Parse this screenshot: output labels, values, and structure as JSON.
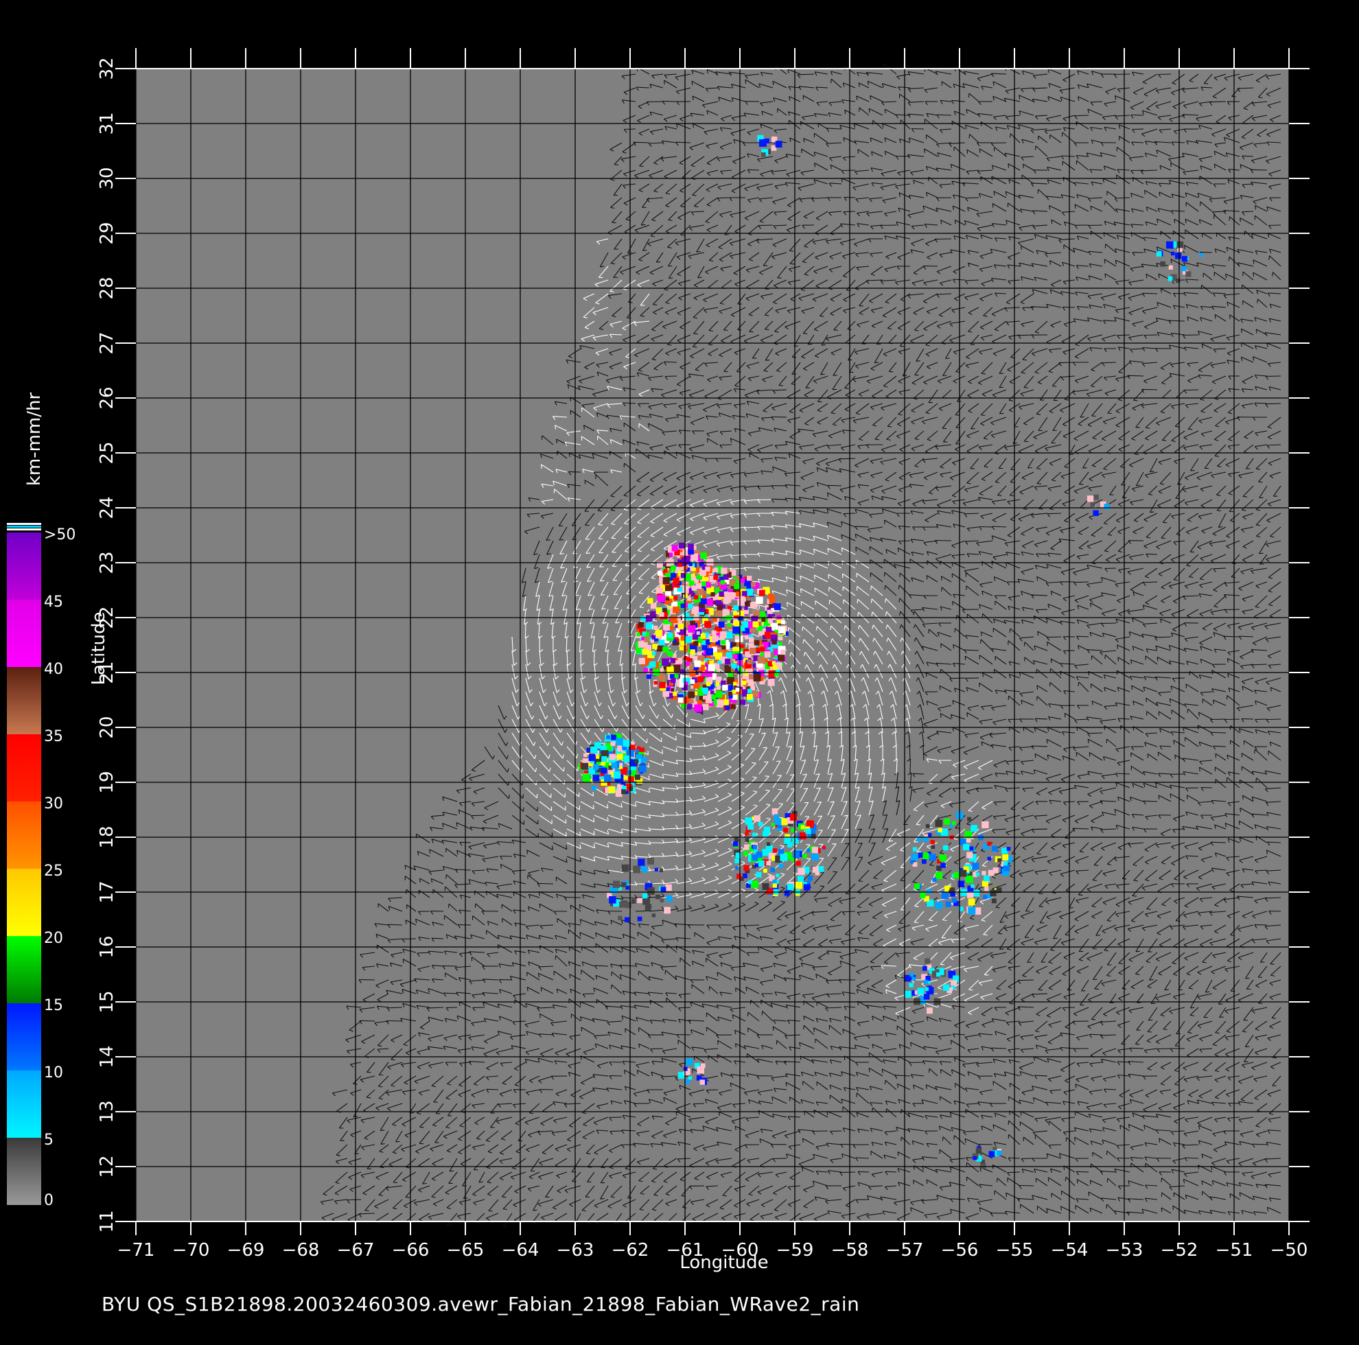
{
  "caption": "BYU  QS_S1B21898.20032460309.avewr_Fabian_21898_Fabian_WRave2_rain",
  "axes": {
    "x_title": "Longitude",
    "y_title": "Latitude",
    "x_range": [
      -71,
      -50
    ],
    "y_range": [
      11,
      32
    ],
    "x_ticks": [
      "-71",
      "-70",
      "-69",
      "-68",
      "-67",
      "-66",
      "-65",
      "-64",
      "-63",
      "-62",
      "-61",
      "-60",
      "-59",
      "-58",
      "-57",
      "-56",
      "-55",
      "-54",
      "-53",
      "-52",
      "-51",
      "-50"
    ],
    "y_ticks": [
      "11",
      "12",
      "13",
      "14",
      "15",
      "16",
      "17",
      "18",
      "19",
      "20",
      "21",
      "22",
      "23",
      "24",
      "25",
      "26",
      "27",
      "28",
      "29",
      "30",
      "31",
      "32"
    ]
  },
  "colorbar": {
    "unit": "km-mm/hr",
    "labels": [
      "0",
      "5",
      "10",
      "15",
      "20",
      "25",
      "30",
      "35",
      "40",
      "45",
      ">50"
    ],
    "segments": [
      {
        "from": 0,
        "to": 5,
        "colors": [
          "#9a9a9a",
          "#3a3a3a"
        ]
      },
      {
        "from": 5,
        "to": 10,
        "colors": [
          "#00f5ff",
          "#00a8ff"
        ]
      },
      {
        "from": 10,
        "to": 15,
        "colors": [
          "#0078ff",
          "#0018ff"
        ]
      },
      {
        "from": 15,
        "to": 20,
        "colors": [
          "#007a00",
          "#00ff00"
        ]
      },
      {
        "from": 20,
        "to": 25,
        "colors": [
          "#ffff00",
          "#ffc800"
        ]
      },
      {
        "from": 25,
        "to": 30,
        "colors": [
          "#ff9400",
          "#ff5000"
        ]
      },
      {
        "from": 30,
        "to": 35,
        "colors": [
          "#ff2000",
          "#ff0000"
        ]
      },
      {
        "from": 35,
        "to": 40,
        "colors": [
          "#c87850",
          "#5a2010"
        ]
      },
      {
        "from": 40,
        "to": 45,
        "colors": [
          "#ff00ff",
          "#e000e8"
        ]
      },
      {
        "from": 45,
        "to": 50,
        "colors": [
          "#c000d8",
          "#7000c8"
        ]
      }
    ]
  },
  "colors": {
    "background": "#000000",
    "map_gray": "#808080",
    "grid": "#000000",
    "wind_dark": "#111111",
    "wind_light": "#ffffff",
    "heavy_rain": "#ffc0cb"
  },
  "storm": {
    "name": "Fabian",
    "center_lon": -60.6,
    "center_lat": 20.6
  },
  "swath": {
    "description_points": [
      [
        -62.0,
        32
      ],
      [
        -62.3,
        29.5
      ],
      [
        -63.0,
        26.5
      ],
      [
        -63.6,
        24.5
      ],
      [
        -64.5,
        20
      ],
      [
        -66.5,
        16.5
      ],
      [
        -67.0,
        14.5
      ],
      [
        -67.5,
        11
      ]
    ]
  },
  "rain_clusters": [
    {
      "lon": -60.5,
      "lat": 21.6,
      "r": 1.3,
      "n": 900,
      "intensity": "heavy"
    },
    {
      "lon": -61.0,
      "lat": 22.9,
      "r": 0.45,
      "n": 120,
      "intensity": "heavy"
    },
    {
      "lon": -62.3,
      "lat": 19.3,
      "r": 0.55,
      "n": 180,
      "intensity": "moderate"
    },
    {
      "lon": -59.3,
      "lat": 17.7,
      "r": 0.8,
      "n": 140,
      "intensity": "moderate"
    },
    {
      "lon": -56.0,
      "lat": 17.5,
      "r": 0.9,
      "n": 120,
      "intensity": "moderate"
    },
    {
      "lon": -56.5,
      "lat": 15.3,
      "r": 0.5,
      "n": 40,
      "intensity": "light"
    },
    {
      "lon": -61.8,
      "lat": 17.0,
      "r": 0.6,
      "n": 40,
      "intensity": "light"
    },
    {
      "lon": -60.8,
      "lat": 13.7,
      "r": 0.3,
      "n": 12,
      "intensity": "light"
    },
    {
      "lon": -52.0,
      "lat": 28.5,
      "r": 0.4,
      "n": 20,
      "intensity": "light"
    },
    {
      "lon": -59.5,
      "lat": 30.6,
      "r": 0.2,
      "n": 10,
      "intensity": "light"
    },
    {
      "lon": -55.5,
      "lat": 12.2,
      "r": 0.25,
      "n": 12,
      "intensity": "light"
    },
    {
      "lon": -53.5,
      "lat": 24.1,
      "r": 0.2,
      "n": 8,
      "intensity": "light"
    }
  ]
}
